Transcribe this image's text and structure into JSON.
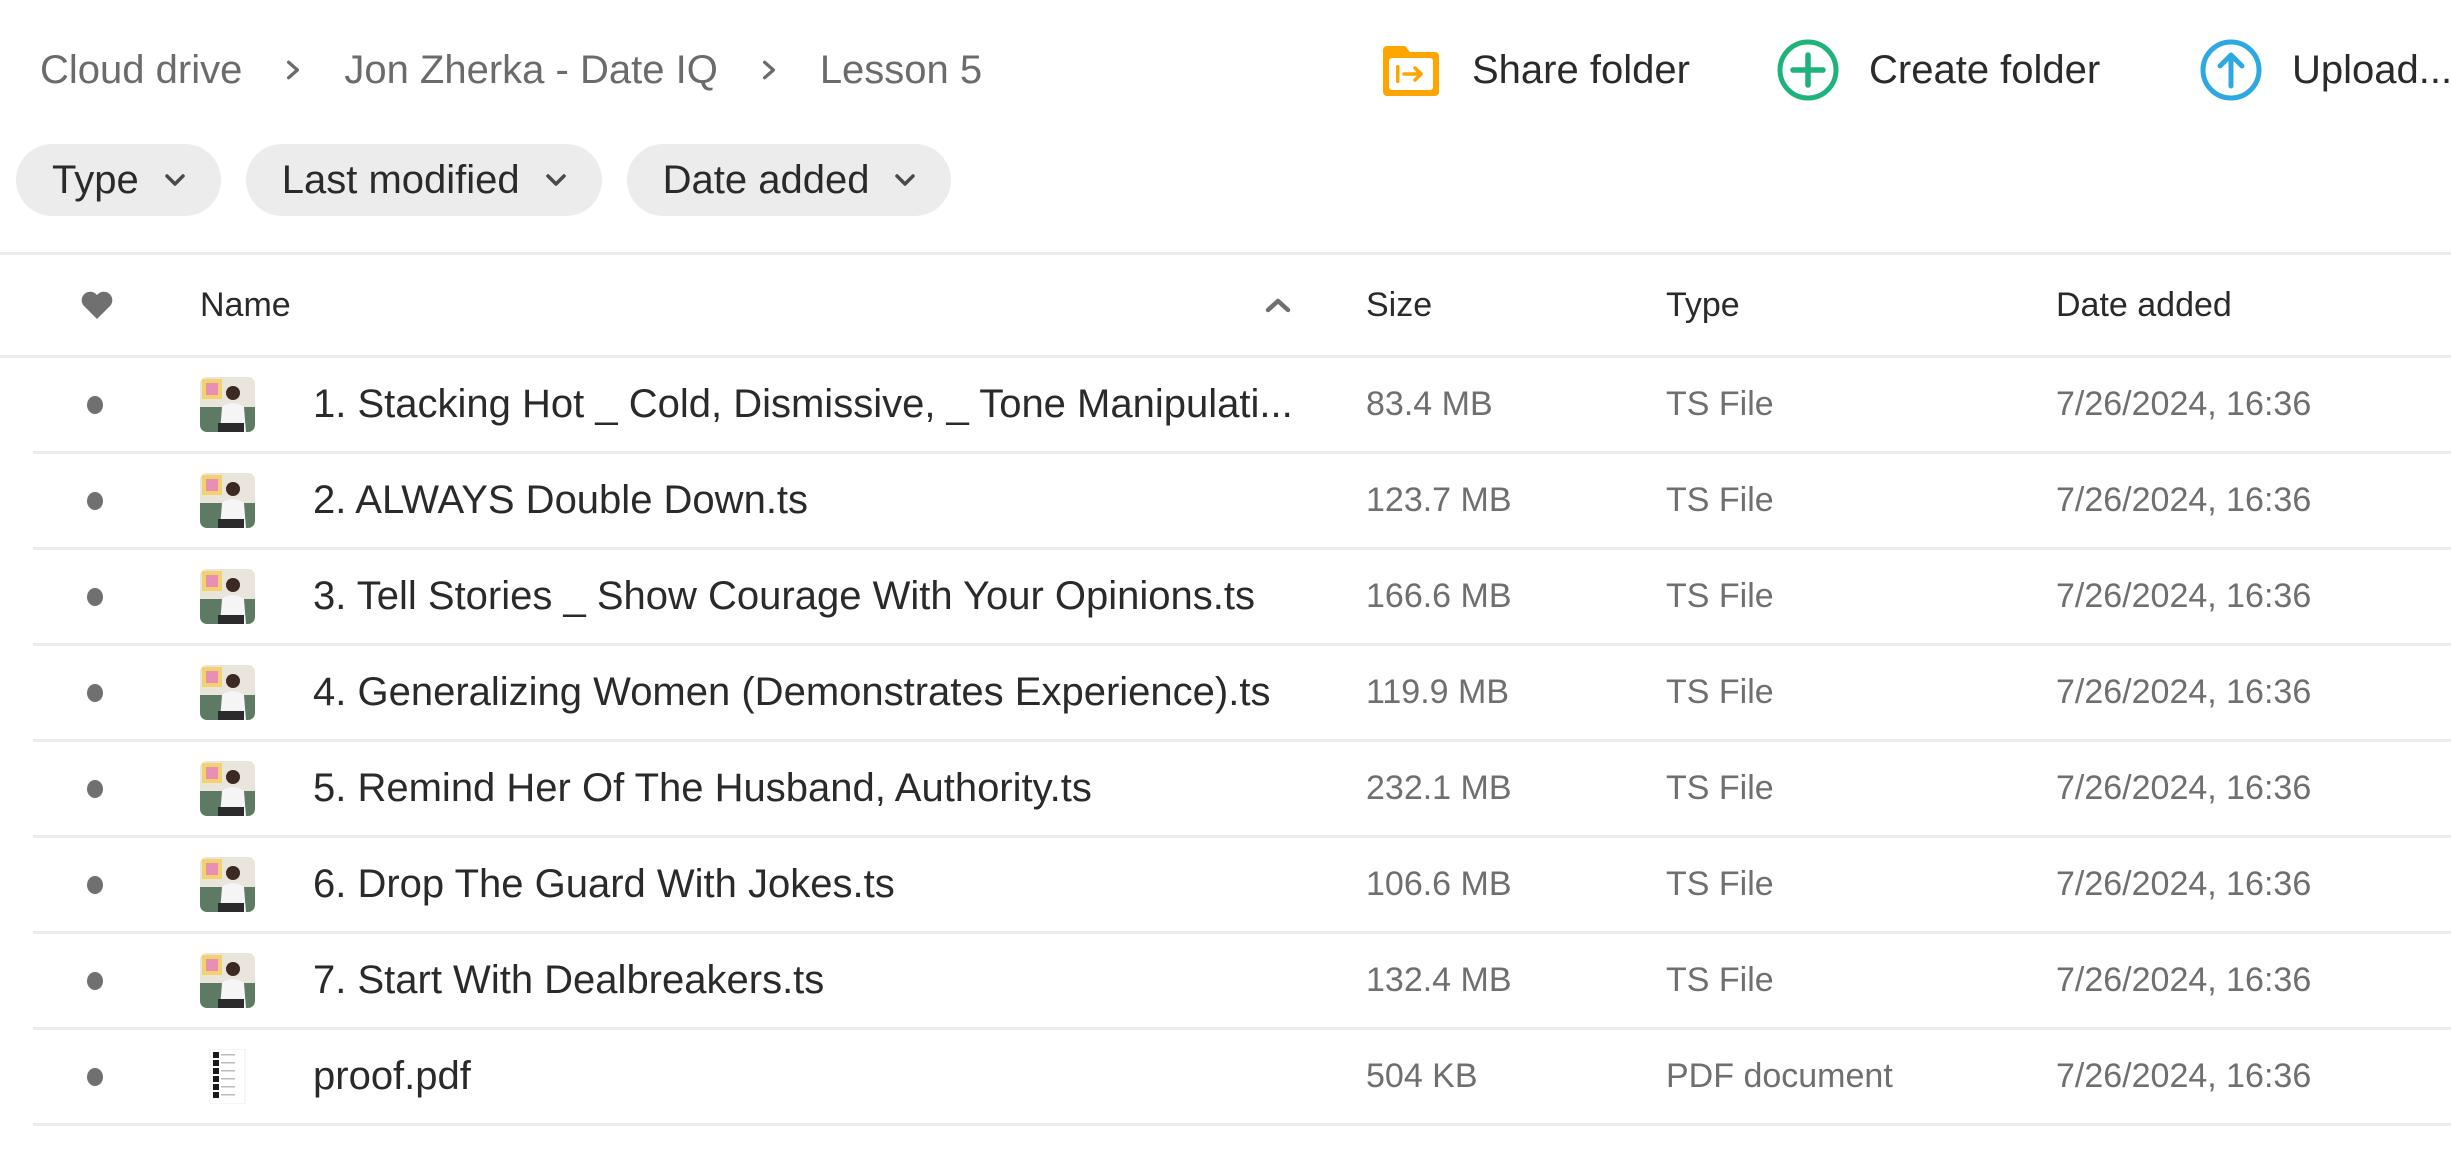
{
  "breadcrumb": [
    {
      "label": "Cloud drive"
    },
    {
      "label": "Jon Zherka - Date IQ"
    },
    {
      "label": "Lesson 5"
    }
  ],
  "actions": {
    "share": {
      "label": "Share folder",
      "icon": "share-folder-icon",
      "color": "#FFA500"
    },
    "create": {
      "label": "Create folder",
      "icon": "plus-circle-icon",
      "color": "#1DB37A"
    },
    "upload": {
      "label": "Upload...",
      "icon": "upload-circle-icon",
      "color": "#2DA8E0"
    }
  },
  "filters": [
    {
      "label": "Type"
    },
    {
      "label": "Last modified"
    },
    {
      "label": "Date added"
    }
  ],
  "table": {
    "columns": {
      "favourite": "heart-icon",
      "name": "Name",
      "size": "Size",
      "type": "Type",
      "date_added": "Date added"
    },
    "sort": {
      "column": "name",
      "direction": "ascending"
    },
    "rows": [
      {
        "name": "1. Stacking Hot _ Cold, Dismissive, _ Tone Manipulati...",
        "size": "83.4 MB",
        "type": "TS File",
        "date_added": "7/26/2024, 16:36",
        "thumb": "video"
      },
      {
        "name": "2. ALWAYS Double Down.ts",
        "size": "123.7 MB",
        "type": "TS File",
        "date_added": "7/26/2024, 16:36",
        "thumb": "video"
      },
      {
        "name": "3. Tell Stories _ Show Courage With Your Opinions.ts",
        "size": "166.6 MB",
        "type": "TS File",
        "date_added": "7/26/2024, 16:36",
        "thumb": "video"
      },
      {
        "name": "4. Generalizing Women (Demonstrates Experience).ts",
        "size": "119.9 MB",
        "type": "TS File",
        "date_added": "7/26/2024, 16:36",
        "thumb": "video"
      },
      {
        "name": "5. Remind Her Of The Husband, Authority.ts",
        "size": "232.1 MB",
        "type": "TS File",
        "date_added": "7/26/2024, 16:36",
        "thumb": "video"
      },
      {
        "name": "6. Drop The Guard With Jokes.ts",
        "size": "106.6 MB",
        "type": "TS File",
        "date_added": "7/26/2024, 16:36",
        "thumb": "video"
      },
      {
        "name": "7. Start With Dealbreakers.ts",
        "size": "132.4 MB",
        "type": "TS File",
        "date_added": "7/26/2024, 16:36",
        "thumb": "video"
      },
      {
        "name": "proof.pdf",
        "size": "504 KB",
        "type": "PDF document",
        "date_added": "7/26/2024, 16:36",
        "thumb": "pdf"
      }
    ]
  }
}
